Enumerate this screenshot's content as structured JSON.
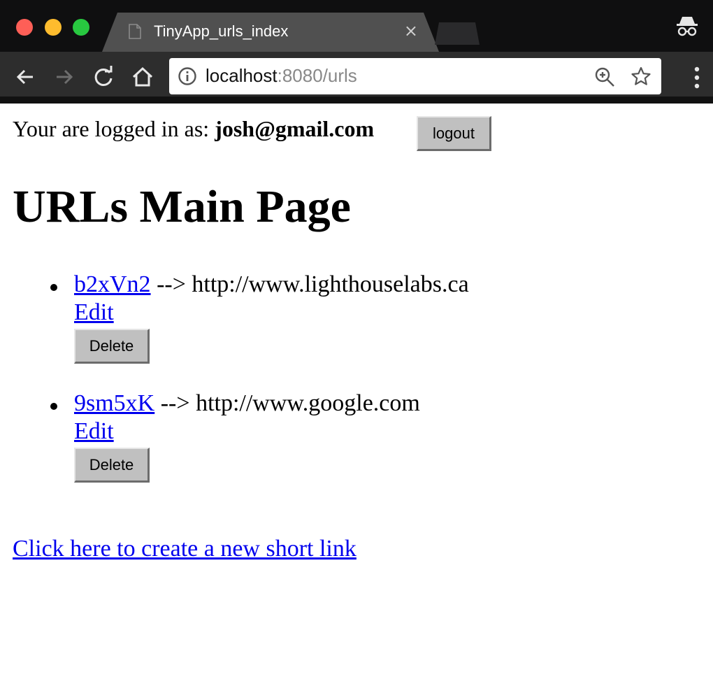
{
  "browser": {
    "tab_title": "TinyApp_urls_index",
    "tab_close": "×",
    "url_host": "localhost",
    "url_rest": ":8080/urls"
  },
  "session": {
    "prefix": "Your are logged in as: ",
    "email": "josh@gmail.com",
    "logout_label": "logout"
  },
  "main": {
    "title": "URLs Main Page",
    "urls": [
      {
        "short": "b2xVn2",
        "arrow": " --> ",
        "long": "http://www.lighthouselabs.ca",
        "edit_label": "Edit",
        "delete_label": "Delete"
      },
      {
        "short": "9sm5xK",
        "arrow": " --> ",
        "long": "http://www.google.com",
        "edit_label": "Edit",
        "delete_label": "Delete"
      }
    ],
    "create_link": "Click here to create a new short link"
  },
  "icons": {
    "back": "arrow-left-icon",
    "forward": "arrow-right-icon",
    "reload": "reload-icon",
    "home": "home-icon",
    "info": "info-icon",
    "zoom": "zoom-in-icon",
    "bookmark": "star-icon",
    "menu": "kebab-menu-icon",
    "incognito": "incognito-icon"
  },
  "colors": {
    "link": "#0000ee",
    "button_bg": "#c0c0c0",
    "chrome_dark": "#2d2d2d"
  }
}
